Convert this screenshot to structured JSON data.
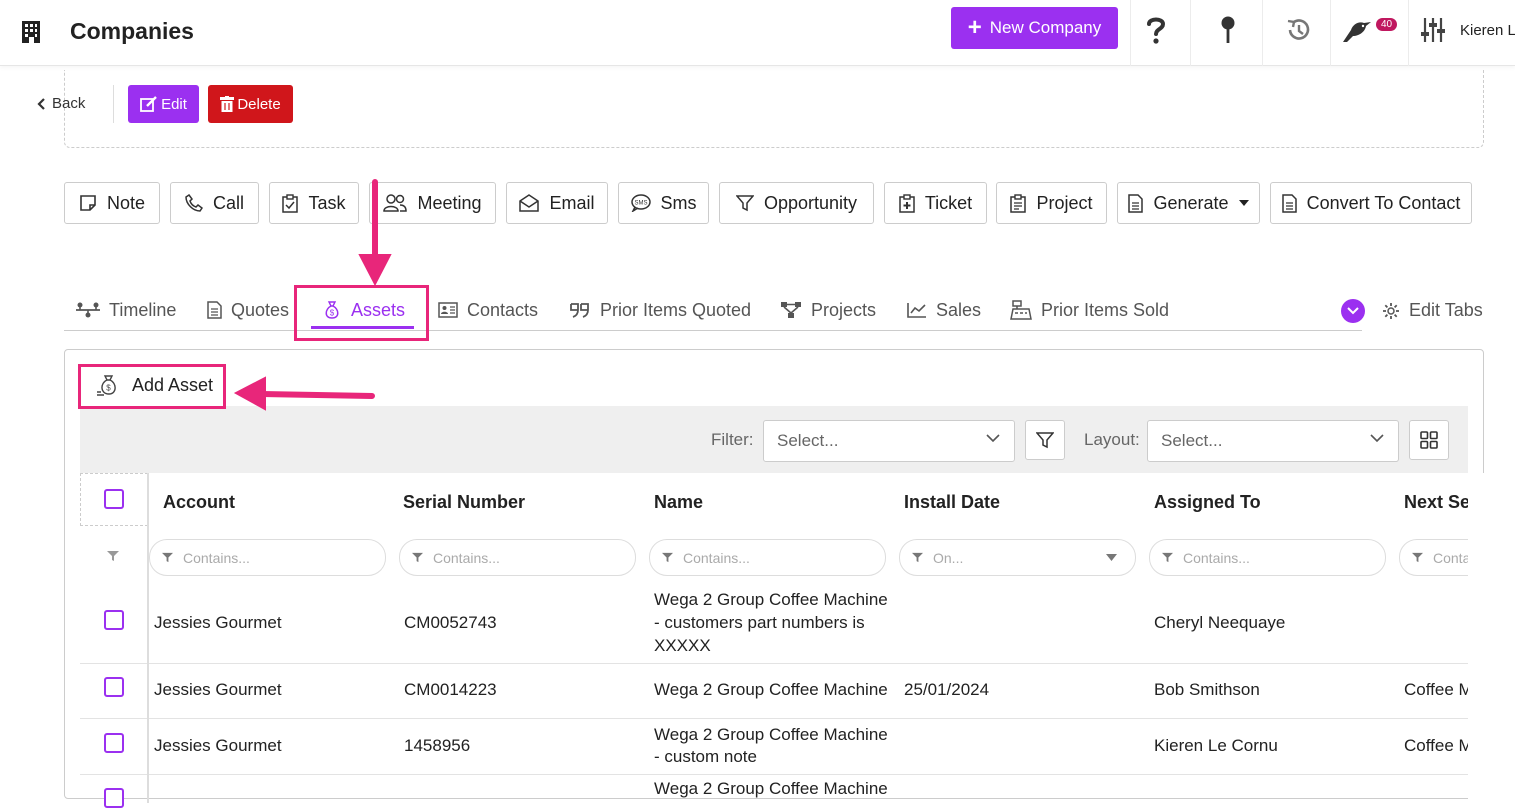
{
  "header": {
    "title": "Companies",
    "new_company_label": "New Company",
    "notification_count": "40",
    "user_name": "Kieren Le Cornu",
    "icons": [
      "building-icon",
      "help-icon",
      "pin-icon",
      "history-icon",
      "bird-icon",
      "sliders-icon"
    ]
  },
  "toolbar": {
    "back_label": "Back",
    "edit_label": "Edit",
    "delete_label": "Delete"
  },
  "actions": [
    {
      "label": "Note",
      "icon": "note-icon"
    },
    {
      "label": "Call",
      "icon": "phone-icon"
    },
    {
      "label": "Task",
      "icon": "clipboard-icon"
    },
    {
      "label": "Meeting",
      "icon": "users-icon"
    },
    {
      "label": "Email",
      "icon": "envelope-open-icon"
    },
    {
      "label": "Sms",
      "icon": "sms-icon"
    },
    {
      "label": "Opportunity",
      "icon": "funnel-icon"
    },
    {
      "label": "Ticket",
      "icon": "ticket-icon"
    },
    {
      "label": "Project",
      "icon": "project-icon"
    },
    {
      "label": "Generate",
      "icon": "document-icon"
    },
    {
      "label": "Convert To Contact",
      "icon": "document-icon"
    }
  ],
  "tabs": [
    {
      "label": "Timeline",
      "icon": "timeline-icon"
    },
    {
      "label": "Quotes",
      "icon": "quote-doc-icon"
    },
    {
      "label": "Assets",
      "icon": "money-bag-icon",
      "active": true
    },
    {
      "label": "Contacts",
      "icon": "contact-card-icon"
    },
    {
      "label": "Prior Items Quoted",
      "icon": "quote-marks-icon"
    },
    {
      "label": "Projects",
      "icon": "sitemap-icon"
    },
    {
      "label": "Sales",
      "icon": "chart-line-icon"
    },
    {
      "label": "Prior Items Sold",
      "icon": "cash-register-icon"
    }
  ],
  "edit_tabs_label": "Edit Tabs",
  "assets": {
    "add_asset_label": "Add Asset",
    "filter_label": "Filter:",
    "filter_placeholder": "Select...",
    "layout_label": "Layout:",
    "layout_placeholder": "Select...",
    "columns": [
      "Account",
      "Serial Number",
      "Name",
      "Install Date",
      "Assigned To",
      "Next Ser"
    ],
    "column_filters": [
      "Contains...",
      "Contains...",
      "Contains...",
      "On...",
      "Contains...",
      "Conta"
    ],
    "rows": [
      {
        "account": "Jessies Gourmet",
        "serial": "CM0052743",
        "name_lines": [
          "Wega 2 Group Coffee Machine",
          "- customers part numbers is",
          "XXXXX"
        ],
        "install_date": "",
        "assigned_to": "Cheryl Neequaye",
        "next": ""
      },
      {
        "account": "Jessies Gourmet",
        "serial": "CM0014223",
        "name_lines": [
          "Wega 2 Group Coffee Machine"
        ],
        "install_date": "25/01/2024",
        "assigned_to": "Bob Smithson",
        "next": "Coffee M"
      },
      {
        "account": "Jessies Gourmet",
        "serial": "1458956",
        "name_lines": [
          "Wega 2 Group Coffee Machine",
          "- custom note"
        ],
        "install_date": "",
        "assigned_to": "Kieren Le Cornu",
        "next": "Coffee M"
      },
      {
        "account": "",
        "serial": "",
        "name_lines": [
          "Wega 2 Group Coffee Machine"
        ],
        "install_date": "",
        "assigned_to": "",
        "next": ""
      }
    ]
  },
  "colors": {
    "accent": "#9b30f0",
    "danger": "#d0161b",
    "annotation": "#e8267a",
    "badge": "#c0185f"
  }
}
